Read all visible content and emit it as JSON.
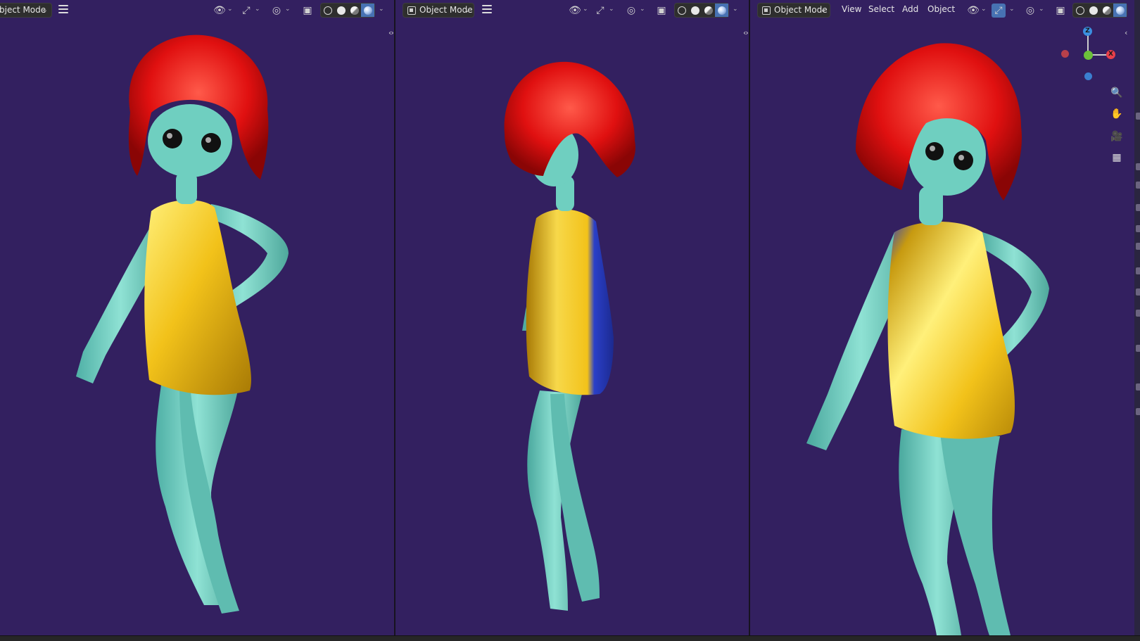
{
  "viewports": [
    {
      "id": "left",
      "header": {
        "mode_label": "bject Mode",
        "menus": []
      }
    },
    {
      "id": "middle",
      "header": {
        "mode_label": "Object Mode",
        "menus": []
      }
    },
    {
      "id": "right",
      "header": {
        "mode_label": "Object Mode",
        "menus": [
          "View",
          "Select",
          "Add",
          "Object"
        ]
      }
    }
  ],
  "gizmo": {
    "z_label": "Z",
    "x_label": "X"
  },
  "icons": {
    "visibility": "eye-icon",
    "gizmo_toggle": "gizmo-icon",
    "overlays": "overlay-icon",
    "xray": "xray-icon",
    "shading_wire": "wireframe-shading-icon",
    "shading_solid": "solid-shading-icon",
    "shading_material": "material-shading-icon",
    "shading_rendered": "rendered-shading-icon",
    "zoom": "zoom-icon",
    "pan": "hand-pan-icon",
    "camera": "camera-icon",
    "ortho": "grid-perspective-icon"
  },
  "colors": {
    "viewport_bg": "#332060",
    "skin": "#6fcfc0",
    "hair": "#e01010",
    "dress": "#f2c21a",
    "dress_shadow": "#2a3fc8",
    "accent": "#4772b3",
    "axis_x": "#e8404a",
    "axis_y": "#6cc23a",
    "axis_z": "#3b8fe0"
  }
}
